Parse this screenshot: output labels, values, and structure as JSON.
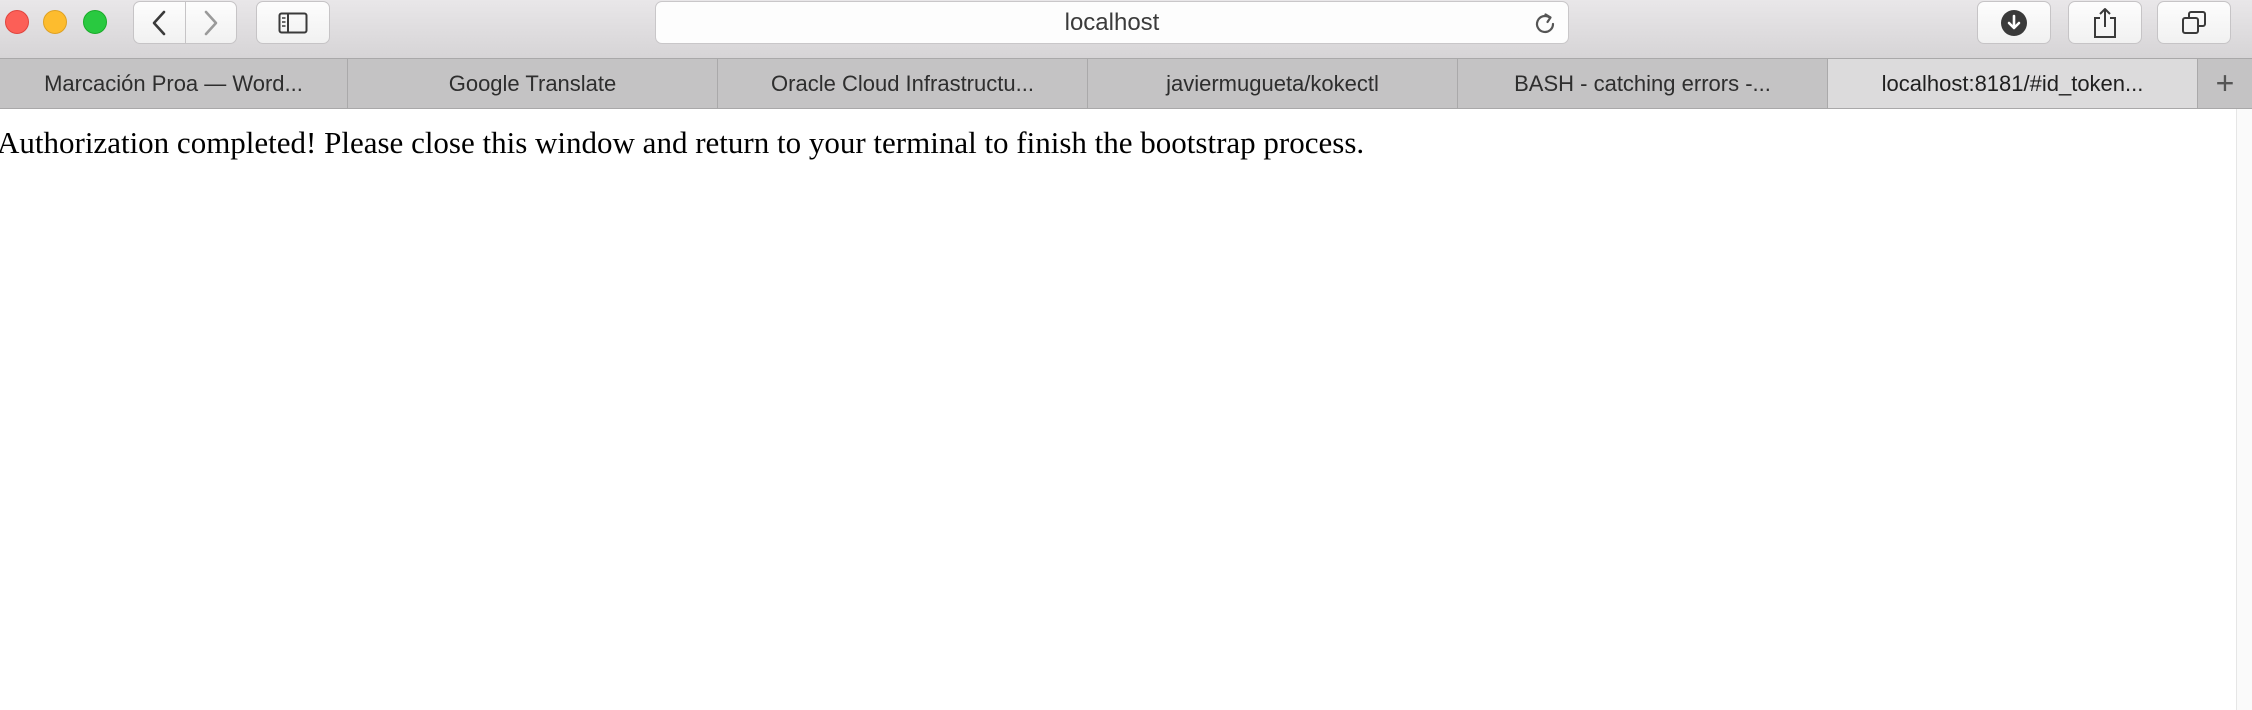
{
  "toolbar": {
    "address": "localhost",
    "icons": {
      "back": "chevron-left-icon",
      "forward": "chevron-right-icon",
      "sidebar": "sidebar-icon",
      "reload": "reload-icon",
      "download": "download-icon",
      "share": "share-icon",
      "tabs": "tabs-overview-icon"
    }
  },
  "tabs": [
    {
      "label": "Marcación Proa — Word..."
    },
    {
      "label": "Google Translate"
    },
    {
      "label": "Oracle Cloud Infrastructu..."
    },
    {
      "label": "javiermugueta/kokectl"
    },
    {
      "label": "BASH - catching errors -..."
    },
    {
      "label": "localhost:8181/#id_token..."
    }
  ],
  "new_tab_label": "+",
  "page": {
    "message": "Authorization completed! Please close this window and return to your terminal to finish the bootstrap process."
  }
}
